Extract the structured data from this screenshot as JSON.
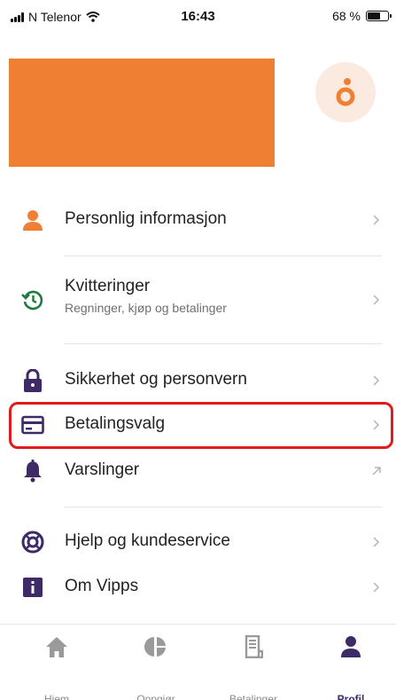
{
  "status_bar": {
    "carrier": "N Telenor",
    "time": "16:43",
    "battery": "68 %",
    "battery_level": 0.68
  },
  "menu": {
    "personal": {
      "label": "Personlig informasjon",
      "icon": "person-icon"
    },
    "receipts": {
      "label": "Kvitteringer",
      "sub": "Regninger, kjøp og betalinger",
      "icon": "history-icon"
    },
    "security": {
      "label": "Sikkerhet og personvern",
      "icon": "lock-icon"
    },
    "payment": {
      "label": "Betalingsvalg",
      "icon": "card-icon"
    },
    "notifications": {
      "label": "Varslinger",
      "icon": "bell-icon"
    },
    "help": {
      "label": "Hjelp og kundeservice",
      "icon": "lifebuoy-icon"
    },
    "about": {
      "label": "Om Vipps",
      "icon": "info-icon"
    }
  },
  "tabs": [
    {
      "label": "Hjem",
      "icon": "home-icon"
    },
    {
      "label": "Oppgjør",
      "icon": "pie-icon"
    },
    {
      "label": "Betalinger",
      "icon": "document-icon"
    },
    {
      "label": "Profil",
      "icon": "profile-icon"
    }
  ],
  "colors": {
    "brand_orange": "#ee7f33",
    "accent_purple": "#3d2a66",
    "receipt_green": "#1f7a3f",
    "highlight_red": "#e11b1b"
  }
}
